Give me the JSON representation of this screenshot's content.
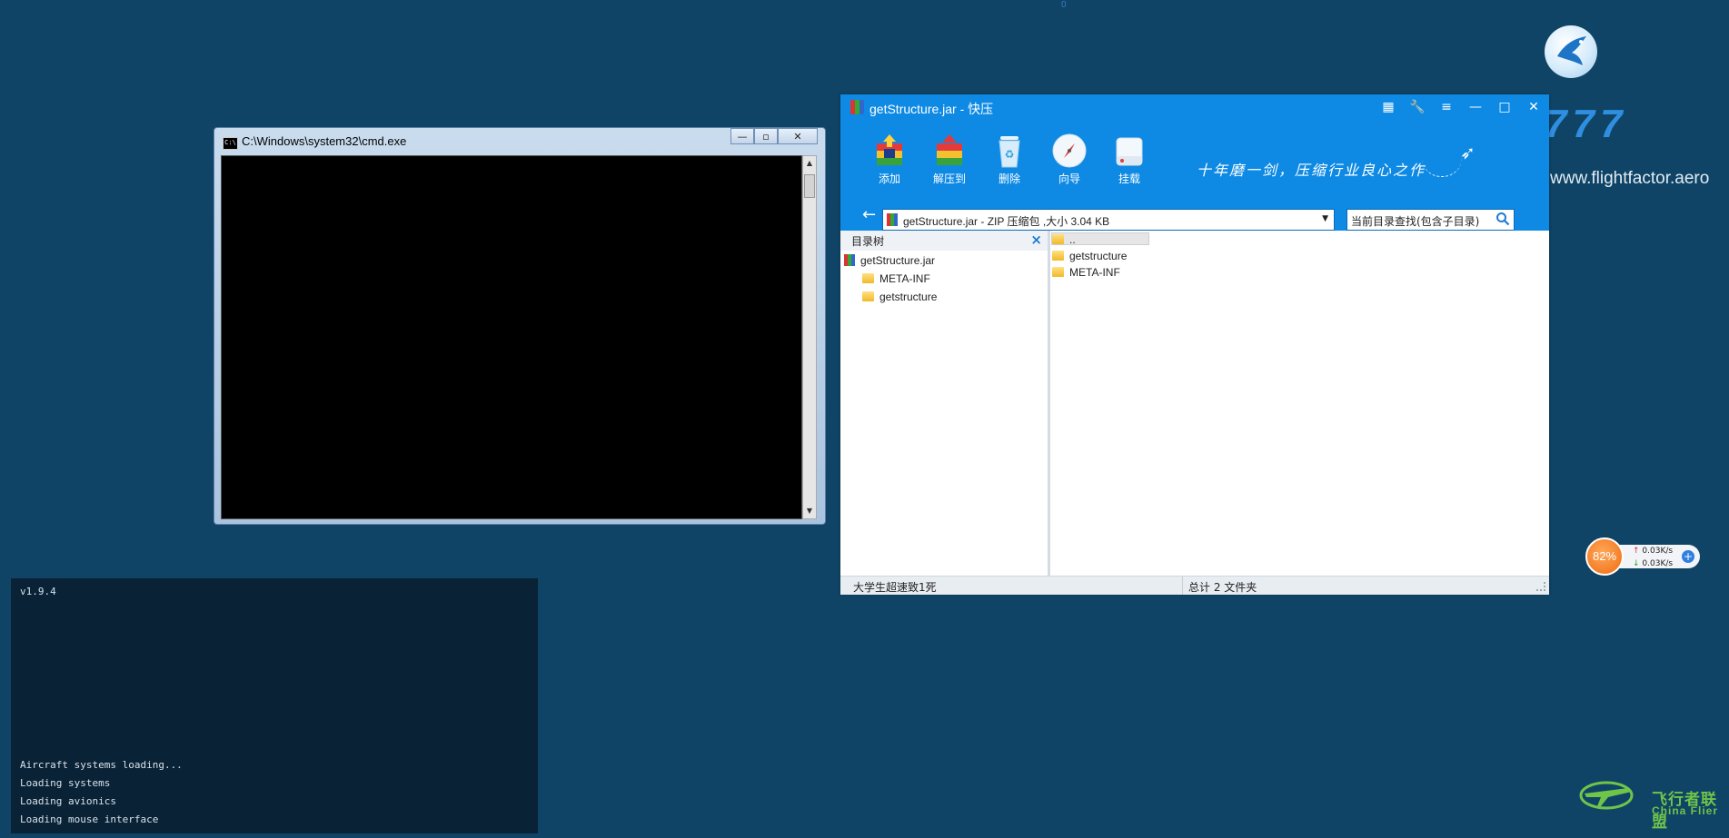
{
  "top_marker": "0",
  "desktop": {
    "brand_mark": "777",
    "brand_url": "www.flightfactor.aero"
  },
  "cmd_window": {
    "title": "C:\\Windows\\system32\\cmd.exe",
    "icon_text": "C:\\",
    "btn_minimize": "—",
    "btn_maximize": "▫",
    "btn_close": "✕"
  },
  "console": {
    "version": "v1.9.4",
    "lines": [
      "Aircraft systems loading...",
      "Loading systems",
      "Loading avionics",
      "Loading mouse interface"
    ]
  },
  "kuaiya": {
    "title": "getStructure.jar - 快压",
    "toolbar": {
      "add": "添加",
      "extract": "解压到",
      "delete": "删除",
      "wizard": "向导",
      "mount": "挂载"
    },
    "slogan": "十年磨一剑，压缩行业良心之作",
    "address": "getStructure.jar - ZIP 压缩包 ,大小 3.04 KB",
    "search_placeholder": "当前目录查找(包含子目录)",
    "tree_title": "目录树",
    "tree": {
      "root": "getStructure.jar",
      "children": [
        "META-INF",
        "getstructure"
      ]
    },
    "files": [
      "..",
      "getstructure",
      "META-INF"
    ],
    "status_left": "大学生超速致1死",
    "status_right": "总计 2 文件夹"
  },
  "network": {
    "percent": "82%",
    "up": "0.03K/s",
    "down": "0.03K/s"
  },
  "watermark": {
    "cn": "飞行者联盟",
    "en": "China Flier"
  },
  "colors": {
    "desktop_bg": "#0f4466",
    "kuaiya_blue": "#0e8ae4",
    "console_bg": "#0a2236",
    "network_orange": "#f06b10"
  }
}
